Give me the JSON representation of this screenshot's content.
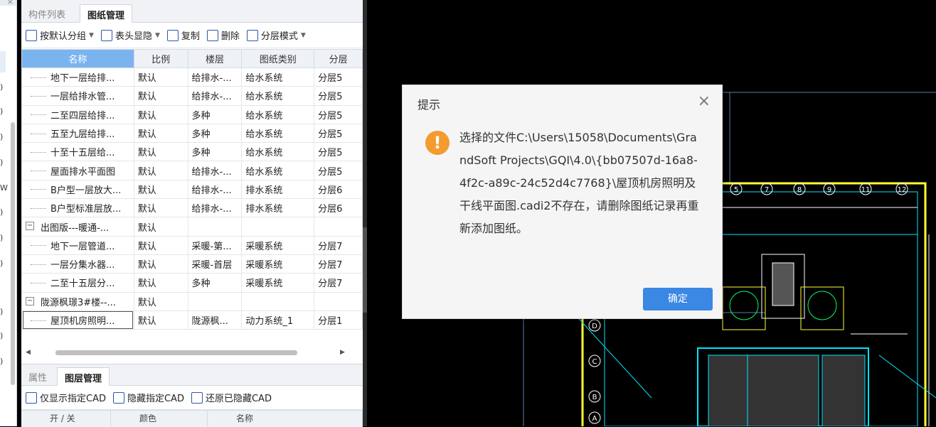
{
  "left_sliver": {
    "close_glyph": "×",
    "glyphs": [
      ")",
      ")",
      ")",
      ")",
      "W",
      ")",
      ")",
      ")",
      ")",
      ")",
      ")"
    ]
  },
  "drawing_panel": {
    "tabs": [
      "构件列表",
      "图纸管理"
    ],
    "active_tab": "图纸管理",
    "toolbar": {
      "group_default": "按默认分组",
      "header_show_hide": "表头显隐",
      "copy": "复制",
      "delete": "删除",
      "layer_mode": "分层模式"
    },
    "columns": [
      "名称",
      "比例",
      "楼层",
      "图纸类别",
      "分层"
    ],
    "rows": [
      {
        "type": "item",
        "name": "地下一层给排...",
        "scale": "默认",
        "floor": "给排水-...",
        "category": "给水系统",
        "layer": "分层5"
      },
      {
        "type": "item",
        "name": "一层给排水管...",
        "scale": "默认",
        "floor": "给排水-...",
        "category": "给水系统",
        "layer": "分层5"
      },
      {
        "type": "item",
        "name": "二至四层给排...",
        "scale": "默认",
        "floor": "多种",
        "category": "给水系统",
        "layer": "分层5"
      },
      {
        "type": "item",
        "name": "五至九层给排...",
        "scale": "默认",
        "floor": "多种",
        "category": "给水系统",
        "layer": "分层5"
      },
      {
        "type": "item",
        "name": "十至十五层给...",
        "scale": "默认",
        "floor": "多种",
        "category": "给水系统",
        "layer": "分层5"
      },
      {
        "type": "item",
        "name": "屋面排水平面图",
        "scale": "默认",
        "floor": "给排水-...",
        "category": "给水系统",
        "layer": "分层5"
      },
      {
        "type": "item",
        "name": "B户型一层放大...",
        "scale": "默认",
        "floor": "给排水-...",
        "category": "排水系统",
        "layer": "分层6"
      },
      {
        "type": "item",
        "name": "B户型标准层放...",
        "scale": "默认",
        "floor": "给排水-...",
        "category": "排水系统",
        "layer": "分层6"
      },
      {
        "type": "group",
        "name": "出图版---暖通-...",
        "scale": "默认",
        "floor": "",
        "category": "",
        "layer": ""
      },
      {
        "type": "item",
        "name": "地下一层管道...",
        "scale": "默认",
        "floor": "采暖-第...",
        "category": "采暖系统",
        "layer": "分层7"
      },
      {
        "type": "item",
        "name": "一层分集水器...",
        "scale": "默认",
        "floor": "采暖-首层",
        "category": "采暖系统",
        "layer": "分层7"
      },
      {
        "type": "item",
        "name": "二至十五层分...",
        "scale": "默认",
        "floor": "多种",
        "category": "采暖系统",
        "layer": "分层7"
      },
      {
        "type": "group",
        "name": "陇源枫璟3#楼--...",
        "scale": "默认",
        "floor": "",
        "category": "",
        "layer": ""
      },
      {
        "type": "item",
        "name": "屋顶机房照明...",
        "scale": "默认",
        "floor": "陇源枫...",
        "category": "动力系统_1",
        "layer": "分层1"
      }
    ]
  },
  "layer_panel": {
    "tabs": [
      "属性",
      "图层管理"
    ],
    "active_tab": "图层管理",
    "toolbar": {
      "show_only": "仅显示指定CAD",
      "hide_selected": "隐藏指定CAD",
      "restore_hidden": "还原已隐藏CAD"
    },
    "header_fragments": [
      "开 / 关",
      "颜色",
      "名称"
    ]
  },
  "dialog": {
    "title": "提示",
    "message": "选择的文件C:\\Users\\15058\\Documents\\GrandSoft Projects\\GQI\\4.0\\{bb07507d-16a8-4f2c-a89c-24c52d4c7768}\\屋顶机房照明及干线平面图.cadi2不存在，请删除图纸记录再重新添加图纸。",
    "ok": "确定",
    "warning_glyph": "!",
    "close_glyph": "×"
  },
  "cad": {
    "column_labels": [
      "5",
      "7",
      "8",
      "9",
      "11",
      "12"
    ],
    "row_labels": [
      "D",
      "C",
      "B",
      "A"
    ],
    "line_color": "#ffff33",
    "accent_colors": [
      "#00e5ff",
      "#00ff66",
      "#ffffff",
      "#4ea0ff"
    ]
  },
  "colors": {
    "header_selected": "#7bb3ef",
    "ok_button": "#3a87e4",
    "warning": "#f39b2e"
  }
}
